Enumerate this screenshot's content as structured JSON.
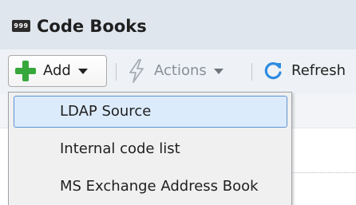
{
  "title_bar": {
    "icon_text": "999",
    "title": "Code Books"
  },
  "toolbar": {
    "add_label": "Add",
    "actions_label": "Actions",
    "refresh_label": "Refresh"
  },
  "add_menu": {
    "items": [
      {
        "label": "LDAP Source",
        "selected": true
      },
      {
        "label": "Internal code list",
        "selected": false
      },
      {
        "label": "MS Exchange Address Book",
        "selected": false
      }
    ]
  },
  "colors": {
    "title_bar_bg": "#dfe6ed",
    "add_icon": "#36a83b",
    "refresh_icon": "#2e8be0",
    "selected_item_border": "#5d93d6",
    "selected_item_bg": "#dcebfb",
    "disabled_text": "#8a8f96"
  },
  "icons": {
    "title": "codebook-icon",
    "add": "plus-icon",
    "actions": "lightning-icon",
    "refresh": "refresh-icon",
    "dropdown": "caret-down-icon"
  }
}
